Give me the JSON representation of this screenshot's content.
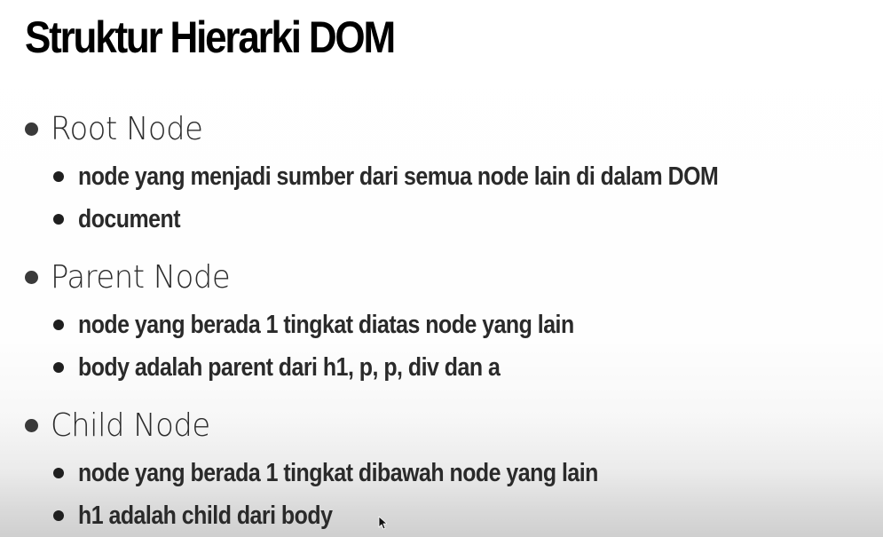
{
  "slide": {
    "title": "Struktur Hierarki DOM",
    "sections": [
      {
        "heading": "Root Node",
        "items": [
          "node yang menjadi sumber dari semua node lain di dalam DOM",
          "document"
        ]
      },
      {
        "heading": "Parent Node",
        "items": [
          "node yang berada 1 tingkat diatas node yang lain",
          "body adalah parent dari h1, p, p, div dan a"
        ]
      },
      {
        "heading": "Child Node",
        "items": [
          "node yang berada 1 tingkat dibawah node yang lain",
          "h1 adalah child dari body"
        ]
      }
    ]
  },
  "icons": {
    "cursor": "mouse-pointer-icon",
    "bullet": "bullet-dot-icon"
  }
}
